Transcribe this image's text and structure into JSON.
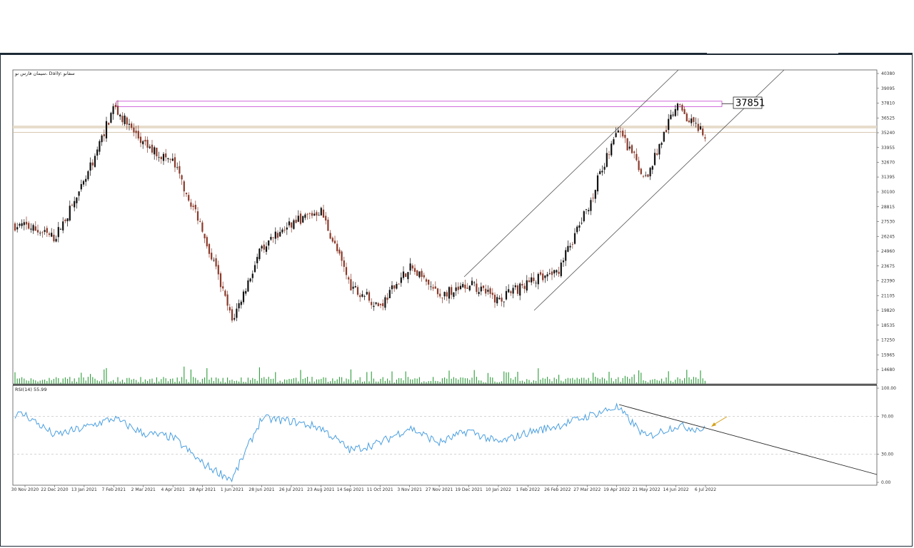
{
  "chart_title": "سیمان فارس نو، Daily: سفانو",
  "annotation": {
    "level_label": "37851",
    "level_value": 37851
  },
  "colors": {
    "bull_candle": "#111111",
    "bear_candle": "#8a3a2a",
    "volume": "#2e9b3a",
    "rsi_line": "#4a9fe0",
    "trendline": "#555555",
    "zone_outline": "#c43fd0",
    "price_band": "#c9b79a",
    "arrow": "#d4a017"
  },
  "chart_data": [
    {
      "type": "candlestick",
      "y_ticks": [
        "40380",
        "39095",
        "37810",
        "36525",
        "35240",
        "33955",
        "32670",
        "31395",
        "30100",
        "28815",
        "27530",
        "26245",
        "24960",
        "23675",
        "22390",
        "21105",
        "19820",
        "18535",
        "17250",
        "15965",
        "14680"
      ],
      "ylim": [
        14680,
        40380
      ],
      "x_ticks": [
        "30 Nov 2020",
        "22 Dec 2020",
        "13 Jan 2021",
        "7 Feb 2021",
        "2 Mar 2021",
        "4 Apr 2021",
        "28 Apr 2021",
        "1 Jun 2021",
        "28 Jun 2021",
        "26 Jul 2021",
        "23 Aug 2021",
        "14 Sep 2021",
        "11 Oct 2021",
        "3 Nov 2021",
        "27 Nov 2021",
        "19 Dec 2021",
        "10 Jan 2022",
        "1 Feb 2022",
        "26 Feb 2022",
        "27 Mar 2022",
        "19 Apr 2022",
        "21 May 2022",
        "14 Jun 2022",
        "6 Jul 2022"
      ],
      "price_path": [
        {
          "x": "30 Nov 2020",
          "y": 27200
        },
        {
          "x": "22 Dec 2020",
          "y": 26100
        },
        {
          "x": "13 Jan 2021",
          "y": 30800
        },
        {
          "x": "7 Feb 2021",
          "y": 37500
        },
        {
          "x": "2 Mar 2021",
          "y": 34200
        },
        {
          "x": "4 Apr 2021",
          "y": 32700
        },
        {
          "x": "28 Apr 2021",
          "y": 27000
        },
        {
          "x": "1 Jun 2021",
          "y": 18900
        },
        {
          "x": "28 Jun 2021",
          "y": 25200
        },
        {
          "x": "26 Jul 2021",
          "y": 27400
        },
        {
          "x": "23 Aug 2021",
          "y": 28500
        },
        {
          "x": "14 Sep 2021",
          "y": 22000
        },
        {
          "x": "11 Oct 2021",
          "y": 20200
        },
        {
          "x": "3 Nov 2021",
          "y": 23600
        },
        {
          "x": "27 Nov 2021",
          "y": 21100
        },
        {
          "x": "19 Dec 2021",
          "y": 22100
        },
        {
          "x": "10 Jan 2022",
          "y": 20700
        },
        {
          "x": "1 Feb 2022",
          "y": 22200
        },
        {
          "x": "26 Feb 2022",
          "y": 23200
        },
        {
          "x": "27 Mar 2022",
          "y": 28600
        },
        {
          "x": "19 Apr 2022",
          "y": 35600
        },
        {
          "x": "21 May 2022",
          "y": 31300
        },
        {
          "x": "14 Jun 2022",
          "y": 37600
        },
        {
          "x": "6 Jul 2022",
          "y": 34900
        }
      ]
    },
    {
      "type": "line",
      "indicator_label": "RSI(14) 55.99",
      "y_ticks": [
        "100.00",
        "70.00",
        "30.00",
        "0.00"
      ],
      "ylim": [
        0,
        100
      ],
      "reference_lines": [
        70,
        30
      ],
      "series": [
        {
          "name": "RSI(14)",
          "values": [
            {
              "x": "30 Nov 2020",
              "y": 72
            },
            {
              "x": "22 Dec 2020",
              "y": 50
            },
            {
              "x": "13 Jan 2021",
              "y": 58
            },
            {
              "x": "7 Feb 2021",
              "y": 68
            },
            {
              "x": "2 Mar 2021",
              "y": 52
            },
            {
              "x": "4 Apr 2021",
              "y": 48
            },
            {
              "x": "28 Apr 2021",
              "y": 20
            },
            {
              "x": "1 Jun 2021",
              "y": 3
            },
            {
              "x": "28 Jun 2021",
              "y": 68
            },
            {
              "x": "26 Jul 2021",
              "y": 65
            },
            {
              "x": "23 Aug 2021",
              "y": 58
            },
            {
              "x": "14 Sep 2021",
              "y": 34
            },
            {
              "x": "11 Oct 2021",
              "y": 42
            },
            {
              "x": "3 Nov 2021",
              "y": 58
            },
            {
              "x": "27 Nov 2021",
              "y": 42
            },
            {
              "x": "19 Dec 2021",
              "y": 55
            },
            {
              "x": "10 Jan 2022",
              "y": 42
            },
            {
              "x": "1 Feb 2022",
              "y": 53
            },
            {
              "x": "26 Feb 2022",
              "y": 60
            },
            {
              "x": "27 Mar 2022",
              "y": 70
            },
            {
              "x": "19 Apr 2022",
              "y": 80
            },
            {
              "x": "21 May 2022",
              "y": 48
            },
            {
              "x": "14 Jun 2022",
              "y": 60
            },
            {
              "x": "6 Jul 2022",
              "y": 56
            }
          ]
        }
      ]
    }
  ]
}
